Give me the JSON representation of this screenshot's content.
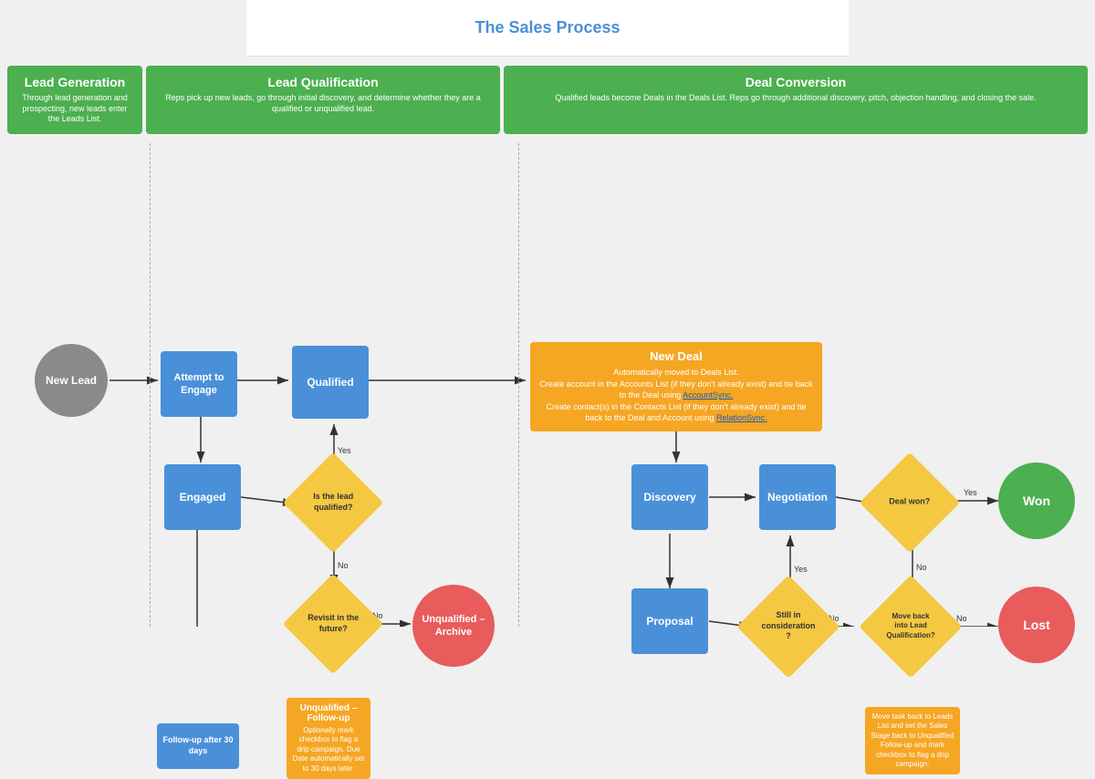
{
  "title": "The Sales Process",
  "phases": [
    {
      "id": "lead-gen",
      "label": "Lead Generation",
      "description": "Through lead generation and prospecting, new leads enter the Leads List."
    },
    {
      "id": "lead-qual",
      "label": "Lead Qualification",
      "description": "Reps pick up new leads, go through initial discovery, and determine whether they are a qualified or unqualified lead."
    },
    {
      "id": "deal-conv",
      "label": "Deal Conversion",
      "description": "Qualified leads become Deals in the Deals List. Reps go through additional discovery, pitch, objection handling, and closing the sale."
    }
  ],
  "nodes": {
    "new_lead": "New Lead",
    "attempt_engage": "Attempt to\nEngage",
    "qualified": "Qualified",
    "new_deal_title": "New Deal",
    "new_deal_desc": "Automatically moved to Deals List.\nCreate account in the Accounts List (if they don't already exist) and tie back to the Deal using",
    "new_deal_link1": "AccountSync.",
    "new_deal_desc2": "Create contact(s) in the Contacts List (if they don't already exist) and tie back to the Deal and Account using",
    "new_deal_link2": "RelationSync.",
    "engaged": "Engaged",
    "qualified_q": "Is the lead\nqualified?",
    "discovery": "Discovery",
    "negotiation": "Negotiation",
    "deal_won_q": "Deal won?",
    "won": "Won",
    "revisit_q": "Revisit in the\nfuture?",
    "unqualified_archive": "Unqualified –\nArchive",
    "proposal": "Proposal",
    "consideration_q": "Still in\nconsideration\n?",
    "move_back_q": "Move back\ninto Lead\nQualification?",
    "lost": "Lost",
    "unqualified_followup_title": "Unqualified –\nFollow-up",
    "unqualified_followup_desc": "Optionally mark checkbox to flag a drip campaign. Due Date automatically set to 30 days later.",
    "followup_30": "Follow-up after 30 days",
    "move_task_back": "Move task back to Leads List and set the Sales Stage back to Unqualified Follow-up and mark checkbox to flag a drip campaign."
  },
  "arrow_labels": {
    "yes": "Yes",
    "no": "No"
  },
  "colors": {
    "gray": "#8a8a8a",
    "blue": "#4a90d9",
    "orange": "#f5a623",
    "yellow": "#f5c842",
    "green": "#4CAF50",
    "red": "#e85c5c",
    "phase_green": "#4CAF50",
    "title_blue": "#4a90d9"
  }
}
